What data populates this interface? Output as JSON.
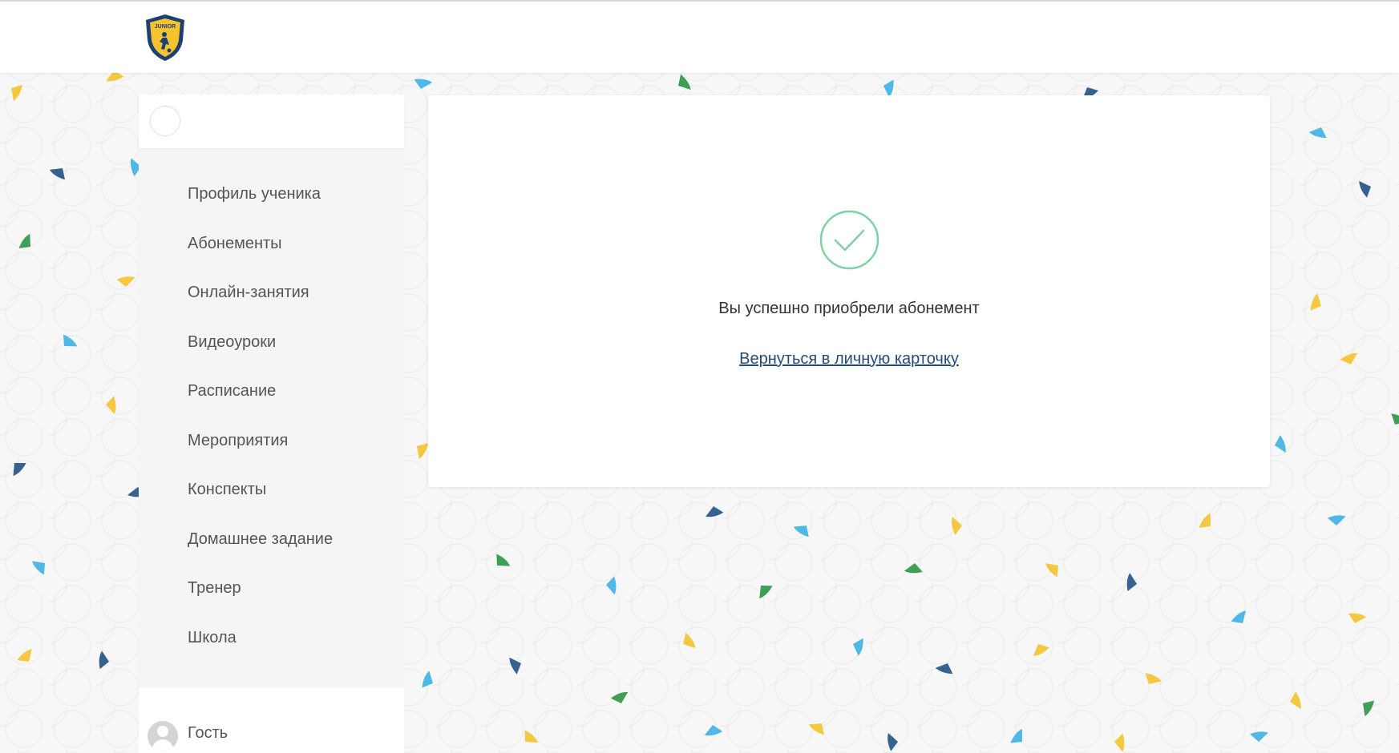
{
  "header": {
    "logo_text": "JUNIOR"
  },
  "sidebar": {
    "items": [
      {
        "label": "Профиль ученика"
      },
      {
        "label": "Абонементы"
      },
      {
        "label": "Онлайн-занятия"
      },
      {
        "label": "Видеоуроки"
      },
      {
        "label": "Расписание"
      },
      {
        "label": "Мероприятия"
      },
      {
        "label": "Конспекты"
      },
      {
        "label": "Домашнее задание"
      },
      {
        "label": "Тренер"
      },
      {
        "label": "Школа"
      }
    ],
    "user": {
      "name": "Гость"
    }
  },
  "main": {
    "success_message": "Вы успешно приобрели абонемент",
    "back_link": "Вернуться в личную карточку"
  },
  "colors": {
    "accent_green": "#7fd1a5",
    "link": "#264b7a",
    "confetti": [
      "#f5c842",
      "#4fb8e6",
      "#3f9f55",
      "#35628f"
    ]
  }
}
